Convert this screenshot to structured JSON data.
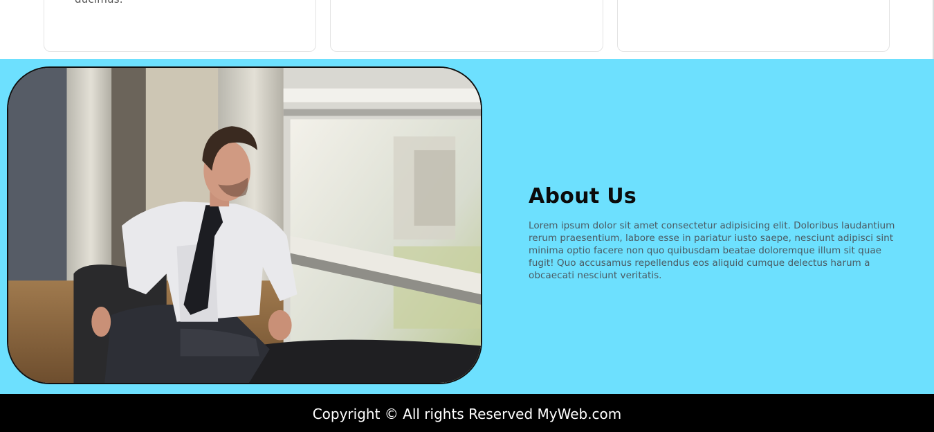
{
  "cards": [
    {
      "text": "ducimus."
    },
    {
      "text": ""
    },
    {
      "text": ""
    }
  ],
  "about": {
    "title": "About Us",
    "body": "Lorem ipsum dolor sit amet consectetur adipisicing elit. Doloribus laudantium rerum praesentium, labore esse in pariatur iusto saepe, nesciunt adipisci sint minima optio facere non quo quibusdam beatae doloremque illum sit quae fugit! Quo accusamus repellendus eos aliquid cumque delectus harum a obcaecati nesciunt veritatis.",
    "image_subject": "man-in-office-chair-by-window"
  },
  "footer": {
    "copyright": "Copyright © All rights Reserved MyWeb.com"
  },
  "colors": {
    "about_background": "#6de0fe",
    "footer_background": "#000000",
    "footer_text": "#ffffff",
    "title_text": "#0b0b0b",
    "body_text": "#4a5a62"
  }
}
